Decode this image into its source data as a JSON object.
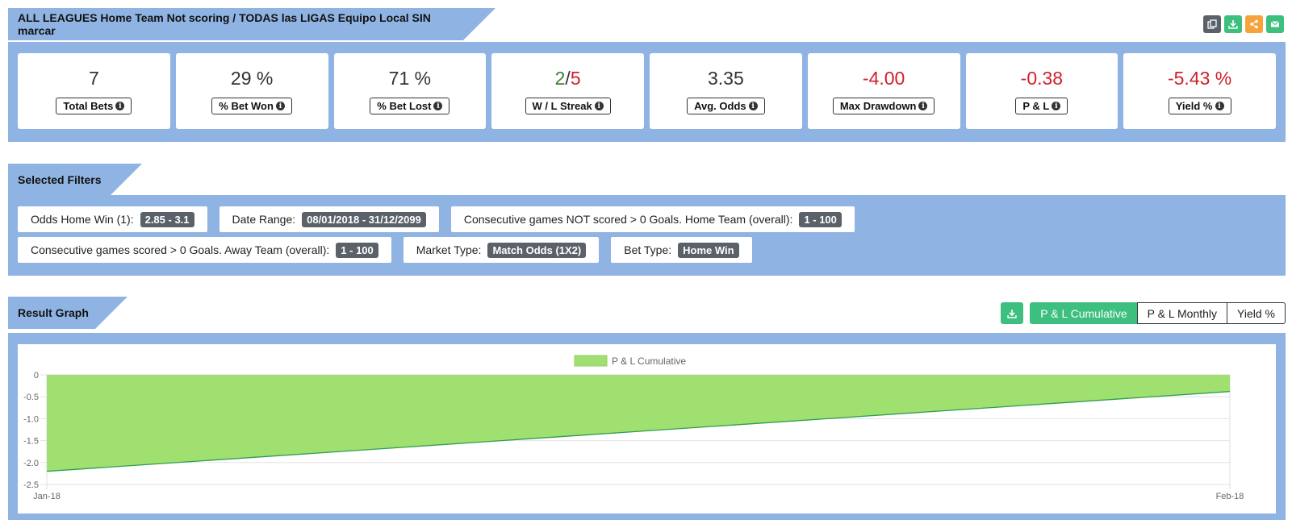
{
  "header": {
    "title": "ALL LEAGUES Home Team Not scoring / TODAS las LIGAS Equipo Local SIN marcar"
  },
  "actions": {
    "copy_icon": "copy-icon",
    "download_icon": "download-icon",
    "share_icon": "share-icon",
    "mail_icon": "mail-icon"
  },
  "kpis": [
    {
      "value": "7",
      "label": "Total Bets"
    },
    {
      "value": "29 %",
      "label": "% Bet Won"
    },
    {
      "value": "71 %",
      "label": "% Bet Lost"
    },
    {
      "value_win": "2",
      "sep": "/",
      "value_loss": "5",
      "label": "W / L Streak"
    },
    {
      "value": "3.35",
      "label": "Avg. Odds"
    },
    {
      "value": "-4.00",
      "label": "Max Drawdown"
    },
    {
      "value": "-0.38",
      "label": "P & L"
    },
    {
      "value": "-5.43 %",
      "label": "Yield %"
    }
  ],
  "filters": {
    "title": "Selected Filters",
    "row1": [
      {
        "label": "Odds Home Win (1):",
        "value": "2.85 - 3.1"
      },
      {
        "label": "Date Range:",
        "value": "08/01/2018 - 31/12/2099"
      },
      {
        "label": "Consecutive games NOT scored > 0 Goals. Home Team (overall):",
        "value": "1 - 100"
      }
    ],
    "row2": [
      {
        "label": "Consecutive games scored > 0 Goals. Away Team (overall):",
        "value": "1 - 100"
      },
      {
        "label": "Market Type:",
        "value": "Match Odds (1X2)"
      },
      {
        "label": "Bet Type:",
        "value": "Home Win"
      }
    ]
  },
  "graph": {
    "title": "Result Graph",
    "tabs": [
      "P & L Cumulative",
      "P & L Monthly",
      "Yield %"
    ],
    "active_tab": 0
  },
  "chart_data": {
    "type": "area",
    "x": [
      "Jan-18",
      "Feb-18"
    ],
    "series": [
      {
        "name": "P & L Cumulative",
        "values": [
          -2.2,
          -0.38
        ],
        "color": "#a0e070",
        "line_color": "#2f9e4f"
      }
    ],
    "yticks": [
      "0",
      "-0.5",
      "-1.0",
      "-1.5",
      "-2.0",
      "-2.5"
    ],
    "ylim": [
      -2.5,
      0
    ],
    "legend": "top-center",
    "grid": true
  }
}
